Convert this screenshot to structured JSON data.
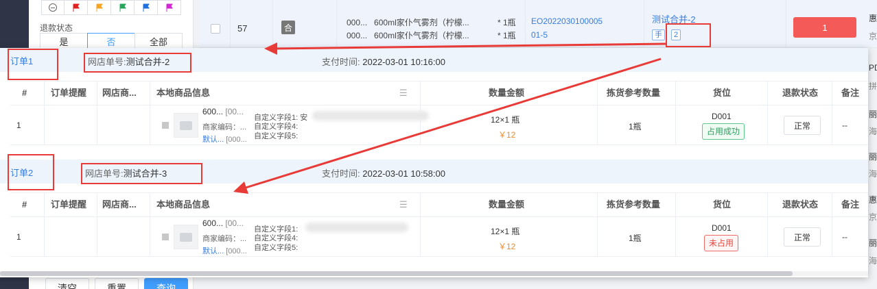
{
  "filter": {
    "flag_colors": [
      "#e02020",
      "#f5a623",
      "#26a65b",
      "#1e6fe0",
      "#d425d4"
    ],
    "refund_label": "退款状态",
    "refund_options": [
      "是",
      "否",
      "全部"
    ],
    "refund_selected": "否",
    "buttons": [
      "清空",
      "重置",
      "查询"
    ]
  },
  "order_row": {
    "index": "57",
    "merge_badge": "合",
    "goods": [
      {
        "code": "000...",
        "name": "600ml家仆气雾剂（柠檬...",
        "qty": "* 1瓶"
      },
      {
        "code": "000...",
        "name": "600ml家仆气雾剂（柠檬...",
        "qty": "* 1瓶"
      }
    ],
    "order_no_line1": "EO2022030100005",
    "order_no_line2": "01-5",
    "merge_name": "测试合并-2",
    "tag_manual": "手",
    "tag_count": "2",
    "red_cell_value": "1",
    "right_fragments": [
      "惠",
      "京",
      "PD",
      "拼",
      "丽",
      "海",
      "丽",
      "海",
      "惠",
      "京",
      "丽",
      "海"
    ]
  },
  "column_headers": [
    "#",
    "订单提醒",
    "网店商...",
    "本地商品信息",
    "数量金额",
    "拣货参考数量",
    "货位",
    "退款状态",
    "备注"
  ],
  "groups": [
    {
      "title": "订单1",
      "shop_label": "网店单号:",
      "shop_value": "测试合并-2",
      "pay_time_label": "支付时间:",
      "pay_time": "2022-03-01 10:16:00",
      "row": {
        "index": "1",
        "product_name": "600...",
        "product_code": "[00...",
        "merchant_code_label": "商家编码：",
        "merchant_code": "...",
        "default_label": "默认...",
        "default_code": "[000...",
        "custom_fields": [
          "自定义字段1: 安",
          "自定义字段4:",
          "自定义字段5:"
        ],
        "qty_amount": "12×1 瓶",
        "price": "￥12",
        "pick_qty": "1瓶",
        "location": "D001",
        "location_status": "占用成功",
        "location_status_type": "ok",
        "refund_status": "正常",
        "remark": "--"
      }
    },
    {
      "title": "订单2",
      "shop_label": "网店单号:",
      "shop_value": "测试合并-3",
      "pay_time_label": "支付时间:",
      "pay_time": "2022-03-01 10:58:00",
      "row": {
        "index": "1",
        "product_name": "600...",
        "product_code": "[00...",
        "merchant_code_label": "商家编码：",
        "merchant_code": "...",
        "default_label": "默认...",
        "default_code": "[000...",
        "custom_fields": [
          "自定义字段1:",
          "自定义字段4:",
          "自定义字段5:"
        ],
        "qty_amount": "12×1 瓶",
        "price": "￥12",
        "pick_qty": "1瓶",
        "location": "D001",
        "location_status": "未占用",
        "location_status_type": "bad",
        "refund_status": "正常",
        "remark": "--"
      }
    }
  ],
  "colors": {
    "accent_blue": "#3a7cd8",
    "annotation_red": "#e83a36",
    "price_orange": "#f08c2d",
    "status_ok": "#2e9d5d",
    "status_bad": "#e6473f"
  }
}
